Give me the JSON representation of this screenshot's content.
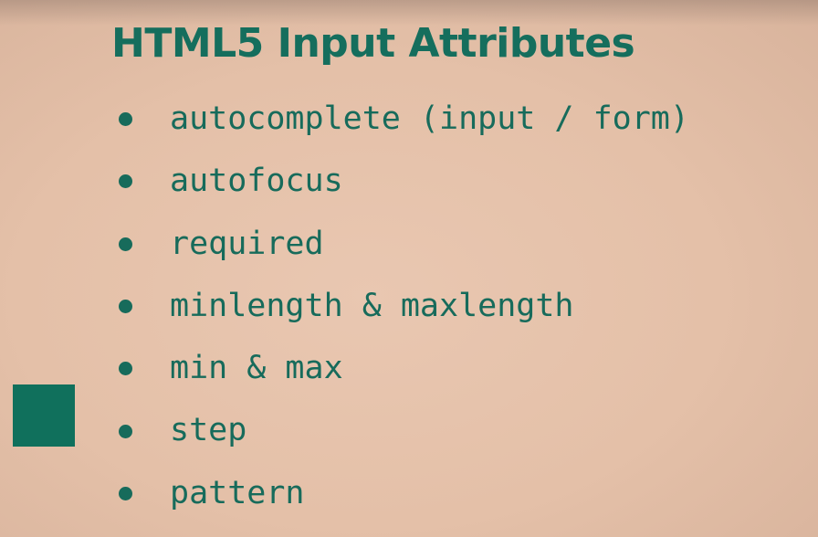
{
  "slide": {
    "title": "HTML5 Input Attributes",
    "bullets": [
      "autocomplete (input / form)",
      "autofocus",
      "required",
      "minlength & maxlength",
      "min & max",
      "step",
      "pattern"
    ]
  },
  "colors": {
    "background": "#e7c4ad",
    "accent": "#156e5d"
  }
}
